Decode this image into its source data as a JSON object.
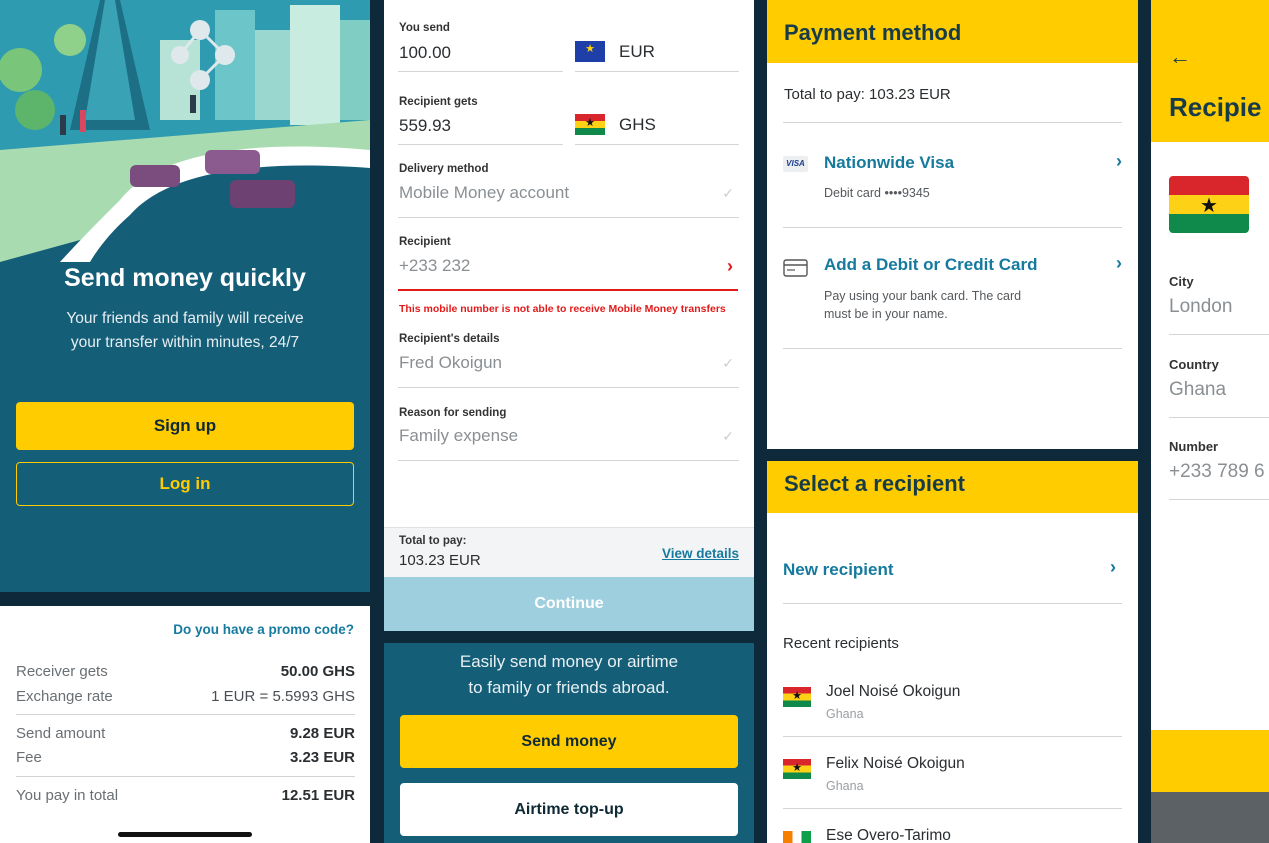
{
  "welcome": {
    "title": "Send money quickly",
    "subtitle_line1": "Your friends and family will receive",
    "subtitle_line2": "your transfer within minutes, 24/7",
    "signup_label": "Sign up",
    "login_label": "Log in"
  },
  "summary": {
    "promo_label": "Do you have a  promo code?",
    "rows": [
      {
        "label": "Receiver gets",
        "value": "50.00 GHS"
      },
      {
        "label": "Exchange rate",
        "value": "1 EUR = 5.5993 GHS"
      },
      {
        "label": "Send amount",
        "value": "9.28 EUR"
      },
      {
        "label": "Fee",
        "value": "3.23 EUR"
      },
      {
        "label": "You pay in total",
        "value": "12.51 EUR"
      }
    ]
  },
  "send_form": {
    "you_send_label": "You send",
    "you_send_value": "100.00",
    "send_currency": "EUR",
    "recipient_gets_label": "Recipient gets",
    "recipient_gets_value": "559.93",
    "receive_currency": "GHS",
    "delivery_label": "Delivery method",
    "delivery_value": "Mobile Money account",
    "recipient_label": "Recipient",
    "recipient_value": "+233 232",
    "error_text": "This mobile number is not able to receive Mobile Money transfers",
    "details_label": "Recipient's details",
    "details_value": "Fred Okoigun",
    "reason_label": "Reason for sending",
    "reason_value": "Family expense",
    "total_label": "Total to pay:",
    "total_value": "103.23 EUR",
    "view_details": "View details",
    "continue_label": "Continue"
  },
  "home": {
    "tagline_line1": "Easily send money or airtime",
    "tagline_line2": "to family or friends abroad.",
    "send_money_label": "Send money",
    "airtime_label": "Airtime top-up"
  },
  "payment": {
    "title": "Payment method",
    "total": "Total to pay: 103.23 EUR",
    "card_badge": "VISA",
    "card_name": "Nationwide Visa",
    "card_detail": "Debit card ••••9345",
    "add_card_title": "Add a Debit or Credit Card",
    "add_card_desc_line1": "Pay using your bank card. The card",
    "add_card_desc_line2": "must be in your name."
  },
  "select_recipient": {
    "title": "Select a recipient",
    "new_recipient": "New recipient",
    "recent_label": "Recent recipients",
    "recipients": [
      {
        "name": "Joel Noisé Okoigun",
        "country": "Ghana"
      },
      {
        "name": "Felix Noisé Okoigun",
        "country": "Ghana"
      },
      {
        "name": "Ese Overo-Tarimo",
        "country": ""
      }
    ]
  },
  "recipient_details": {
    "title": "Recipie",
    "city_label": "City",
    "city_value": "London",
    "country_label": "Country",
    "country_value": "Ghana",
    "number_label": "Number",
    "number_value": "+233 789 6"
  },
  "colors": {
    "brand_yellow": "#ffcc00",
    "brand_teal": "#155e78",
    "link_blue": "#157a9e",
    "error_red": "#e21b1b"
  }
}
